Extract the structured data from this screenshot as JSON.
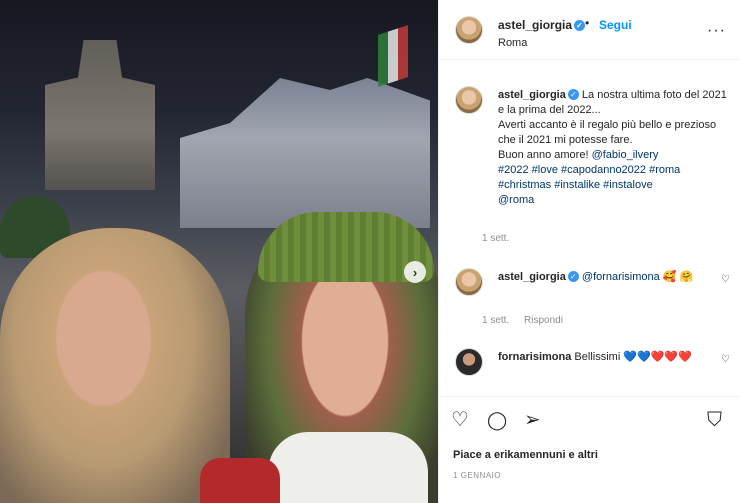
{
  "post": {
    "username": "astel_giorgia",
    "verified_glyph": "✓",
    "separator": "•",
    "follow_label": "Segui",
    "location": "Roma",
    "more_label": "···"
  },
  "caption": {
    "username": "astel_giorgia",
    "text_1": "La nostra ultima foto del 2021 e la prima del 2022...",
    "text_2": "Averti accanto è il regalo più bello e prezioso che il 2021 mi potesse fare.",
    "text_3": "Buon anno amore! ",
    "mention_1": "@fabio_ilvery",
    "hashtags": "#2022 #love #capodanno2022 #roma #christmas #instalike #instalove",
    "mention_2": "@roma",
    "time": "1 sett."
  },
  "comments": [
    {
      "username": "astel_giorgia",
      "mention": "@fornarisimona",
      "emoji": "🥰 🤗",
      "time": "1 sett.",
      "reply_label": "Rispondi"
    },
    {
      "username": "fornarisimona",
      "text": "Bellissimi",
      "emoji": "💙💙❤️❤️❤️"
    }
  ],
  "actions": {
    "like_icon": "♡",
    "comment_icon": "◯",
    "share_icon": "➢",
    "save_icon": "⛉",
    "likes_text": "Piace a erikamennuni e altri",
    "date": "1 GENNAIO"
  },
  "photo": {
    "next_icon": "›"
  },
  "icons": {
    "heart_small": "♡"
  },
  "colors": {
    "accent": "#0095f6",
    "verified": "#3897f0",
    "link": "#00376b",
    "muted": "#8e8e8e"
  }
}
